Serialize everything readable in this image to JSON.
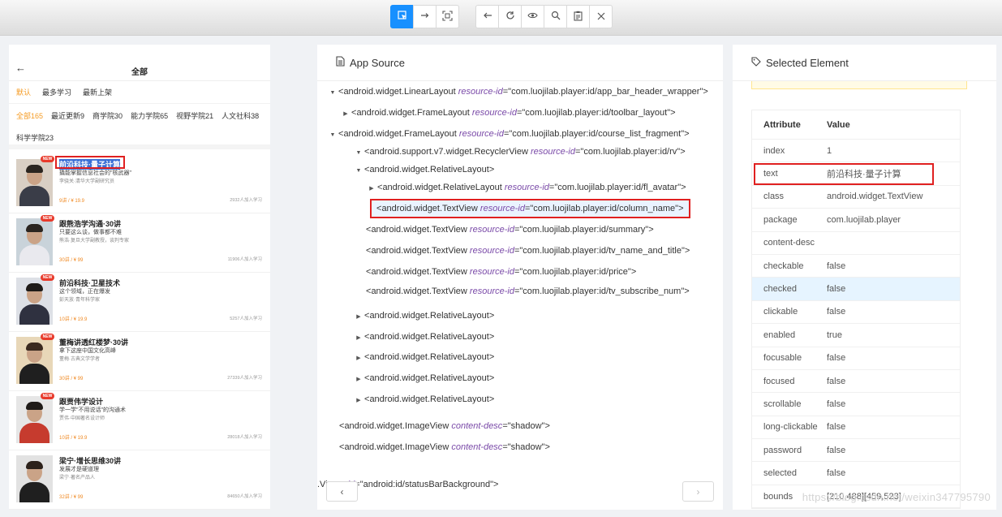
{
  "toolbar": {
    "groups": [
      [
        {
          "icon": "select-element-icon",
          "active": true
        },
        {
          "icon": "swipe-icon",
          "active": false
        },
        {
          "icon": "screenshot-frame-icon",
          "active": false
        }
      ],
      [
        {
          "icon": "back-arrow-icon",
          "active": false
        },
        {
          "icon": "refresh-icon",
          "active": false
        },
        {
          "icon": "eye-icon",
          "active": false
        },
        {
          "icon": "search-icon",
          "active": false
        },
        {
          "icon": "clipboard-icon",
          "active": false
        },
        {
          "icon": "close-icon",
          "active": false
        }
      ]
    ]
  },
  "phone": {
    "back_glyph": "←",
    "title": "全部",
    "sort_tabs": [
      {
        "label": "默认",
        "active": true
      },
      {
        "label": "最多学习",
        "active": false
      },
      {
        "label": "最新上架",
        "active": false
      }
    ],
    "categories": [
      {
        "label": "全部165",
        "active": true
      },
      {
        "label": "最近更新9",
        "active": false
      },
      {
        "label": "商学院30",
        "active": false
      },
      {
        "label": "能力学院65",
        "active": false
      },
      {
        "label": "视野学院21",
        "active": false
      },
      {
        "label": "人文社科38",
        "active": false
      },
      {
        "label": "科学学院23",
        "active": false
      }
    ],
    "new_tag": "NEW",
    "courses": [
      {
        "title": "前沿科技·量子计算",
        "summary": "撬能掌握信息社会的\"核武器\"",
        "author": "李骁关·清华大学副研究员",
        "price": "9讲 / ¥ 19.9",
        "subscribers": "2932人加入学习",
        "is_new": true,
        "selected": true
      },
      {
        "title": "跟熊浩学沟通·30讲",
        "summary": "只要这么谈，做事都不难",
        "author": "熊浩·复旦大学副教授，谈判专家",
        "price": "30讲 / ¥ 99",
        "subscribers": "11906人加入学习",
        "is_new": true,
        "selected": false
      },
      {
        "title": "前沿科技·卫星技术",
        "summary": "这个领域，正在爆发",
        "author": "彭天放·青年科学家",
        "price": "10讲 / ¥ 19.9",
        "subscribers": "5257人加入学习",
        "is_new": true,
        "selected": false
      },
      {
        "title": "董梅讲透红楼梦·30讲",
        "summary": "拿下这座中国文化高峰",
        "author": "董梅·古典文学学者",
        "price": "30讲 / ¥ 99",
        "subscribers": "27339人加入学习",
        "is_new": true,
        "selected": false
      },
      {
        "title": "跟贾伟学设计",
        "summary": "学一学\"不用说话\"的沟通术",
        "author": "贾伟·中国著名设计师",
        "price": "10讲 / ¥ 19.9",
        "subscribers": "28018人加入学习",
        "is_new": true,
        "selected": false
      },
      {
        "title": "梁宁·增长思维30讲",
        "summary": "发展才是硬道理",
        "author": "梁宁·著名产品人",
        "price": "32讲 / ¥ 99",
        "subscribers": "84650人加入学习",
        "is_new": false,
        "selected": false
      }
    ]
  },
  "source": {
    "title": "App Source",
    "nodes": [
      {
        "toggle": "▼",
        "tag": "android.widget.LinearLayout",
        "attr": "resource-id",
        "value": "com.luojilab.player:id/app_bar_header_wrapper",
        "selected": false
      },
      {
        "toggle": "▶",
        "tag": "android.widget.FrameLayout",
        "attr": "resource-id",
        "value": "com.luojilab.player:id/toolbar_layout",
        "selected": false
      },
      {
        "toggle": "▼",
        "tag": "android.widget.FrameLayout",
        "attr": "resource-id",
        "value": "com.luojilab.player:id/course_list_fragment",
        "selected": false
      },
      {
        "toggle": "▼",
        "tag": "android.support.v7.widget.RecyclerView",
        "attr": "resource-id",
        "value": "com.luojilab.player:id/rv",
        "selected": false
      },
      {
        "toggle": "▼",
        "tag": "android.widget.RelativeLayout",
        "attr": "",
        "value": "",
        "selected": false
      },
      {
        "toggle": "▶",
        "tag": "android.widget.RelativeLayout",
        "attr": "resource-id",
        "value": "com.luojilab.player:id/fl_avatar",
        "selected": false
      },
      {
        "toggle": "",
        "tag": "android.widget.TextView",
        "attr": "resource-id",
        "value": "com.luojilab.player:id/column_name",
        "selected": true
      },
      {
        "toggle": "",
        "tag": "android.widget.TextView",
        "attr": "resource-id",
        "value": "com.luojilab.player:id/summary",
        "selected": false
      },
      {
        "toggle": "",
        "tag": "android.widget.TextView",
        "attr": "resource-id",
        "value": "com.luojilab.player:id/tv_name_and_title",
        "selected": false
      },
      {
        "toggle": "",
        "tag": "android.widget.TextView",
        "attr": "resource-id",
        "value": "com.luojilab.player:id/price",
        "selected": false
      },
      {
        "toggle": "",
        "tag": "android.widget.TextView",
        "attr": "resource-id",
        "value": "com.luojilab.player:id/tv_subscribe_num",
        "selected": false
      },
      {
        "toggle": "▶",
        "tag": "android.widget.RelativeLayout",
        "attr": "",
        "value": "",
        "selected": false
      },
      {
        "toggle": "▶",
        "tag": "android.widget.RelativeLayout",
        "attr": "",
        "value": "",
        "selected": false
      },
      {
        "toggle": "▶",
        "tag": "android.widget.RelativeLayout",
        "attr": "",
        "value": "",
        "selected": false
      },
      {
        "toggle": "▶",
        "tag": "android.widget.RelativeLayout",
        "attr": "",
        "value": "",
        "selected": false
      },
      {
        "toggle": "▶",
        "tag": "android.widget.RelativeLayout",
        "attr": "",
        "value": "",
        "selected": false
      },
      {
        "toggle": "",
        "tag": "android.widget.ImageView",
        "attr": "content-desc",
        "value": "shadow",
        "selected": false
      },
      {
        "toggle": "",
        "tag": "android.widget.ImageView",
        "attr": "content-desc",
        "value": "shadow",
        "selected": false
      }
    ],
    "cut_line": {
      "prefix": ".Vi",
      "attr": "urce-id",
      "value": "android:id/statusBarBackground"
    },
    "prev_glyph": "‹",
    "next_glyph": "›"
  },
  "selected": {
    "title": "Selected Element",
    "headers": {
      "attribute": "Attribute",
      "value": "Value"
    },
    "rows": [
      {
        "key": "index",
        "value": "1"
      },
      {
        "key": "text",
        "value": "前沿科技·量子计算",
        "highlight": true
      },
      {
        "key": "class",
        "value": "android.widget.TextView"
      },
      {
        "key": "package",
        "value": "com.luojilab.player"
      },
      {
        "key": "content-desc",
        "value": ""
      },
      {
        "key": "checkable",
        "value": "false"
      },
      {
        "key": "checked",
        "value": "false",
        "hover": true
      },
      {
        "key": "clickable",
        "value": "false"
      },
      {
        "key": "enabled",
        "value": "true"
      },
      {
        "key": "focusable",
        "value": "false"
      },
      {
        "key": "focused",
        "value": "false"
      },
      {
        "key": "scrollable",
        "value": "false"
      },
      {
        "key": "long-clickable",
        "value": "false"
      },
      {
        "key": "password",
        "value": "false"
      },
      {
        "key": "selected",
        "value": "false"
      },
      {
        "key": "bounds",
        "value": "[210,488][459,523]"
      }
    ]
  },
  "watermark": "https://blog.csdn.net/weixin347795790",
  "colors": {
    "accent": "#1890ff",
    "highlight_border": "#e02020",
    "orange": "#f59b23"
  }
}
